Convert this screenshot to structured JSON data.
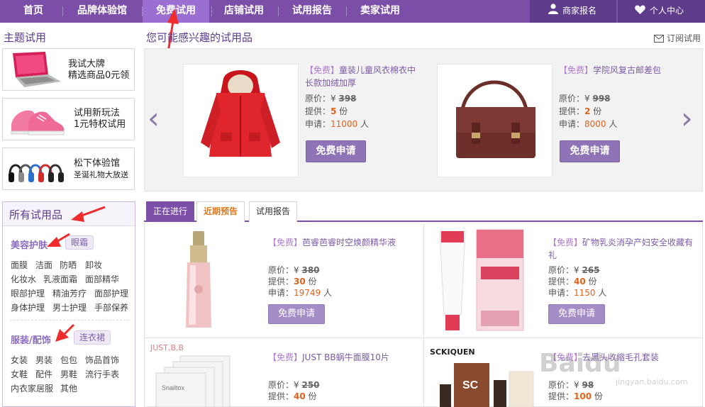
{
  "nav": {
    "items": [
      "首页",
      "品牌体验馆",
      "免费试用",
      "店铺试用",
      "试用报告",
      "卖家试用"
    ],
    "active_index": 2,
    "merchant_signup": "商家报名",
    "user_center": "个人中心"
  },
  "left": {
    "section_title": "主题试用",
    "promos": [
      {
        "line1": "我试大牌",
        "line2": "精选商品0元领"
      },
      {
        "line1": "试用新玩法",
        "line2": "1元特权试用"
      },
      {
        "line1": "松下体验馆",
        "line2": "圣诞礼物大放送"
      }
    ],
    "all_products_title": "所有试用品",
    "categories": [
      {
        "name": "美容护肤",
        "tag": "眼霜",
        "items": [
          "面膜",
          "洁面",
          "防晒",
          "卸妆",
          "化妆水",
          "乳液面霜",
          "面部精华",
          "眼部护理",
          "精油芳疗",
          "面部护理",
          "身体护理",
          "男士护理",
          "手部保养"
        ]
      },
      {
        "name": "服装/配饰",
        "tag": "连衣裙",
        "items": [
          "女装",
          "男装",
          "包包",
          "饰品首饰",
          "女鞋",
          "配件",
          "男鞋",
          "流行手表",
          "内衣家居服",
          "其他"
        ]
      }
    ]
  },
  "main": {
    "title": "您可能感兴趣的试用品",
    "subscribe": "订阅试用",
    "labels": {
      "free": "【免费】",
      "orig": "原价：",
      "supply": "提供：",
      "apply": "申请：",
      "yen": "¥",
      "unit_fen": "份",
      "unit_ren": "人"
    },
    "carousel": [
      {
        "name": "童装儿童风衣棉衣中长款加绒加厚",
        "orig": "398",
        "supply": "5",
        "apply": "11000",
        "button": "免费申请"
      },
      {
        "name": "学院风复古邮差包",
        "orig": "998",
        "supply": "2",
        "apply": "8000",
        "button": "免费申请"
      }
    ],
    "tabs": [
      "正在进行",
      "近期预告",
      "试用报告"
    ],
    "products": [
      {
        "name": "芭睿芭睿时空焕颜精华液",
        "orig": "380",
        "supply": "30",
        "apply": "19749",
        "button": "免费申请"
      },
      {
        "name": "矿物乳炎消孕产妇安全收藏有礼",
        "orig": "265",
        "supply": "40",
        "apply": "1150",
        "button": "免费申请"
      },
      {
        "name": "JUST BB蜗牛面膜10片",
        "orig": "250",
        "supply": "40",
        "apply": "",
        "button": "免费申请",
        "brand": "JUST,B,B"
      },
      {
        "name": "去黑头收缩毛孔套装",
        "orig": "98",
        "supply": "100",
        "apply": "",
        "button": "免费申请",
        "brand": "SCKIQUEN"
      }
    ]
  },
  "colors": {
    "nav_bg": "#7b4fa8",
    "accent": "#7b5aa6",
    "price_red": "#e4611c"
  },
  "watermark": {
    "text": "Baidu",
    "sub": "jingyan.baidu.com"
  }
}
